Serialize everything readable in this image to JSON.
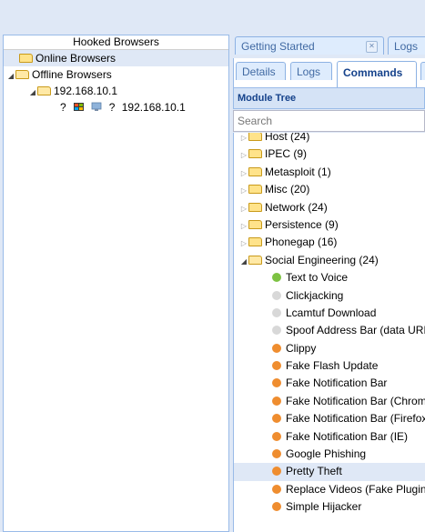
{
  "left_panel": {
    "header": "Hooked Browsers",
    "online": "Online Browsers",
    "offline": "Offline Browsers",
    "host": "192.168.10.1",
    "browser_label": "192.168.10.1",
    "unknown_glyph": "?"
  },
  "tabs": {
    "getting_started": "Getting Started",
    "logs": "Logs",
    "details": "Details",
    "logs2": "Logs",
    "commands": "Commands"
  },
  "module_panel": {
    "title": "Module Tree",
    "search_placeholder": "Search"
  },
  "colors": {
    "green": "#7dc242",
    "gray": "#d8d8d8",
    "orange": "#ef8d2f",
    "selected_bg": "#dfe8f6",
    "header_text": "#15428b"
  },
  "module_tree": [
    {
      "type": "folder",
      "label": "Host (24)",
      "expanded": false
    },
    {
      "type": "folder",
      "label": "IPEC (9)",
      "expanded": false
    },
    {
      "type": "folder",
      "label": "Metasploit (1)",
      "expanded": false
    },
    {
      "type": "folder",
      "label": "Misc (20)",
      "expanded": false
    },
    {
      "type": "folder",
      "label": "Network (24)",
      "expanded": false
    },
    {
      "type": "folder",
      "label": "Persistence (9)",
      "expanded": false
    },
    {
      "type": "folder",
      "label": "Phonegap (16)",
      "expanded": false
    },
    {
      "type": "folder",
      "label": "Social Engineering (24)",
      "expanded": true
    },
    {
      "type": "module",
      "label": "Text to Voice",
      "status": "green"
    },
    {
      "type": "module",
      "label": "Clickjacking",
      "status": "gray"
    },
    {
      "type": "module",
      "label": "Lcamtuf Download",
      "status": "gray"
    },
    {
      "type": "module",
      "label": "Spoof Address Bar (data URI)",
      "status": "gray"
    },
    {
      "type": "module",
      "label": "Clippy",
      "status": "orange"
    },
    {
      "type": "module",
      "label": "Fake Flash Update",
      "status": "orange"
    },
    {
      "type": "module",
      "label": "Fake Notification Bar",
      "status": "orange"
    },
    {
      "type": "module",
      "label": "Fake Notification Bar (Chrome)",
      "status": "orange"
    },
    {
      "type": "module",
      "label": "Fake Notification Bar (Firefox)",
      "status": "orange"
    },
    {
      "type": "module",
      "label": "Fake Notification Bar (IE)",
      "status": "orange"
    },
    {
      "type": "module",
      "label": "Google Phishing",
      "status": "orange"
    },
    {
      "type": "module",
      "label": "Pretty Theft",
      "status": "orange",
      "selected": true
    },
    {
      "type": "module",
      "label": "Replace Videos (Fake Plugin)",
      "status": "orange"
    },
    {
      "type": "module",
      "label": "Simple Hijacker",
      "status": "orange"
    }
  ]
}
